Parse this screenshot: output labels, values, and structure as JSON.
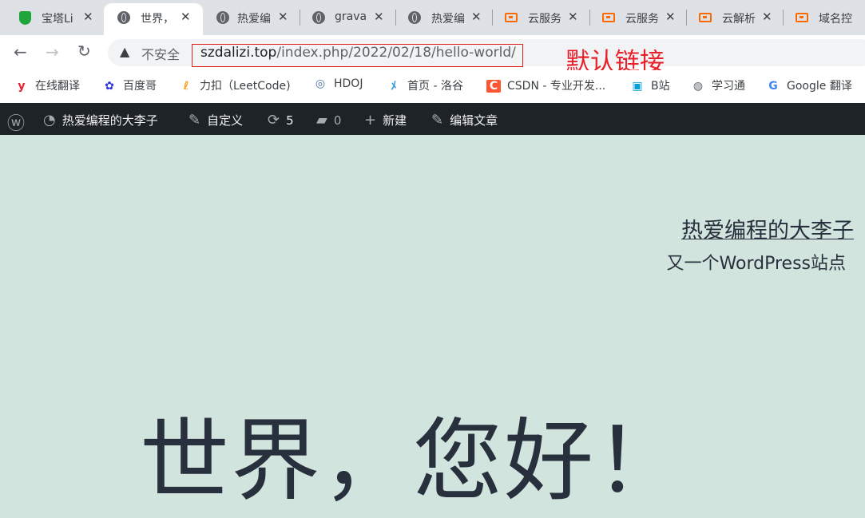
{
  "browser": {
    "tabs": [
      {
        "title": "宝塔Li",
        "icon": "shield-icon"
      },
      {
        "title": "世界，",
        "icon": "globe-icon"
      },
      {
        "title": "热爱编",
        "icon": "globe-icon"
      },
      {
        "title": "grava",
        "icon": "globe-icon"
      },
      {
        "title": "热爱编",
        "icon": "globe-icon"
      },
      {
        "title": "云服务",
        "icon": "aliyun-icon"
      },
      {
        "title": "云服务",
        "icon": "aliyun-icon"
      },
      {
        "title": "云解析",
        "icon": "aliyun-icon"
      },
      {
        "title": "域名控",
        "icon": "aliyun-icon"
      }
    ],
    "close_glyph": "✕",
    "nav": {
      "back": "←",
      "forward": "→",
      "reload": "↻"
    },
    "security_label": "不安全",
    "url_host": "szdalizi.top",
    "url_path": "/index.php/2022/02/18/hello-world/",
    "annotation": "默认链接",
    "bookmarks": [
      {
        "label": "在线翻译",
        "icon": "youdao-icon"
      },
      {
        "label": "百度哥",
        "icon": "baidu-icon"
      },
      {
        "label": "力扣（LeetCode)",
        "icon": "leetcode-icon"
      },
      {
        "label": "HDOJ",
        "icon": "hdoj-icon"
      },
      {
        "label": "首页 - 洛谷",
        "icon": "luogu-icon"
      },
      {
        "label": "CSDN - 专业开发...",
        "icon": "csdn-icon"
      },
      {
        "label": "B站",
        "icon": "bilibili-icon"
      },
      {
        "label": "学习通",
        "icon": "globe-icon"
      },
      {
        "label": "Google 翻译",
        "icon": "google-translate-icon"
      }
    ]
  },
  "admin_bar": {
    "site_name": "热爱编程的大李子",
    "customize": "自定义",
    "updates_count": "5",
    "comments_count": "0",
    "new_label": "新建",
    "edit_label": "编辑文章"
  },
  "site": {
    "title": "热爱编程的大李子",
    "description": "又一个WordPress站点"
  },
  "post": {
    "title": "世界，您好！"
  },
  "colors": {
    "page_bg": "#d1e4dd",
    "admin_bar_bg": "#1d2327",
    "annotation_red": "#e8202a",
    "aliyun_orange": "#ff6a00"
  }
}
